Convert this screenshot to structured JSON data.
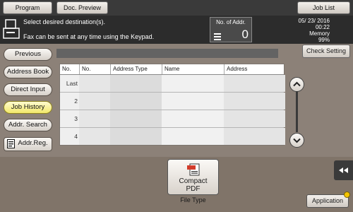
{
  "top_tabs": {
    "program": "Program",
    "doc_preview": "Doc. Preview",
    "job_list": "Job List"
  },
  "status": {
    "message1": "Select desired destination(s).",
    "message2": "Fax can be sent at any time using the Keypad.",
    "addr_label": "No. of Addr.",
    "addr_count": "0",
    "date": "05/ 23/ 2016",
    "time": "00:22",
    "memory_label": "Memory",
    "memory_value": "99%"
  },
  "nav": {
    "previous": "Previous",
    "address_book": "Address Book",
    "direct_input": "Direct Input",
    "job_history": "Job History",
    "addr_search": "Addr. Search",
    "addr_reg": "Addr.Reg."
  },
  "check_setting": "Check Setting",
  "table": {
    "headers": [
      "No.",
      "No.",
      "Address Type",
      "Name",
      "Address"
    ],
    "rows": [
      {
        "num": "Last"
      },
      {
        "num": "2"
      },
      {
        "num": "3"
      },
      {
        "num": "4"
      }
    ]
  },
  "file_type": {
    "line1": "Compact",
    "line2": "PDF",
    "label": "File Type"
  },
  "application": "Application",
  "colors": {
    "active_tab": "#f2e86a",
    "panel": "#8c8178",
    "dark_bar": "#2c2c2c"
  }
}
